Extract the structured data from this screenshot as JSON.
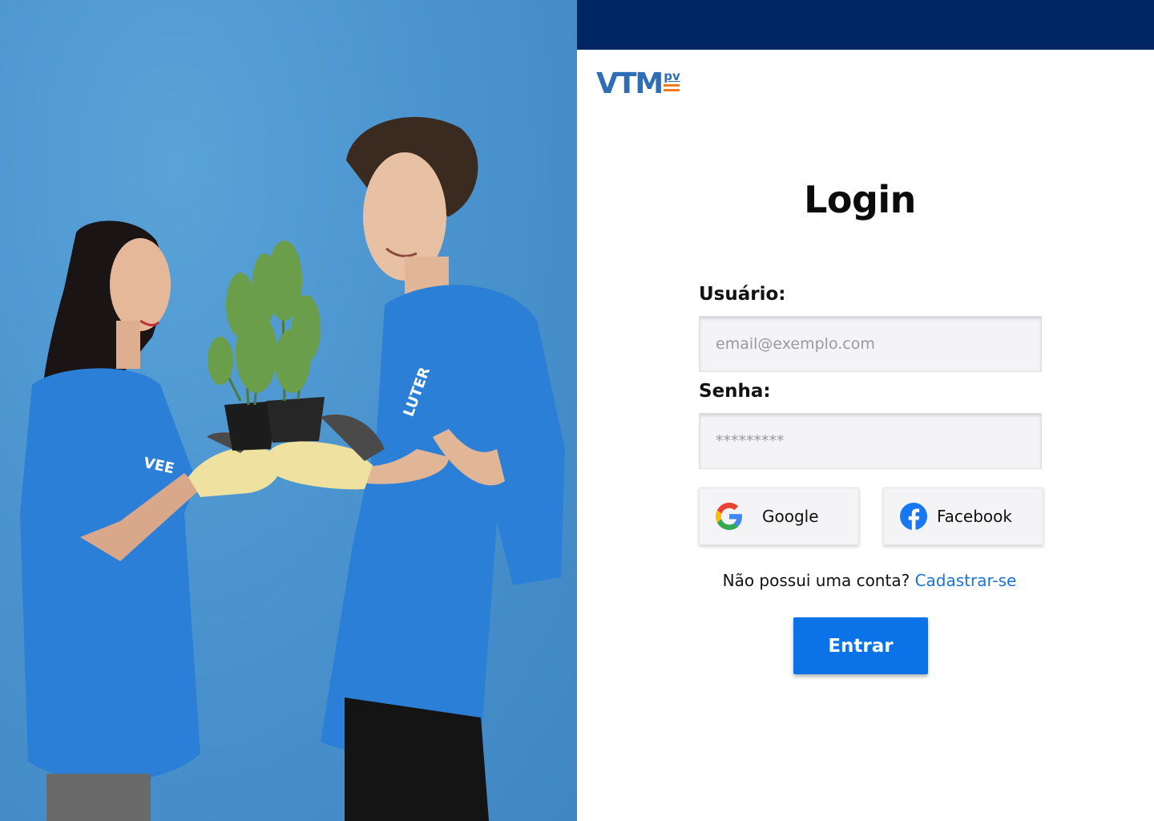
{
  "brand": {
    "name": "VTM",
    "suffix": "pv"
  },
  "login": {
    "title": "Login",
    "username_label": "Usuário:",
    "username_placeholder": "email@exemplo.com",
    "password_label": "Senha:",
    "password_placeholder": "*********",
    "google_label": "Google",
    "facebook_label": "Facebook",
    "no_account_text": "Não possui uma conta?",
    "signup_link": "Cadastrar-se",
    "submit_label": "Entrar"
  },
  "photo": {
    "shirt_text_left": "VEE",
    "shirt_text_right": "LUTER"
  },
  "colors": {
    "topbar": "#002563",
    "brand_blue": "#2f6db5",
    "brand_orange": "#f07a1e",
    "primary_button": "#0b72e7",
    "link": "#1a73d9",
    "photo_background": "#4b94cf",
    "shirt_blue": "#2b7fd6"
  }
}
